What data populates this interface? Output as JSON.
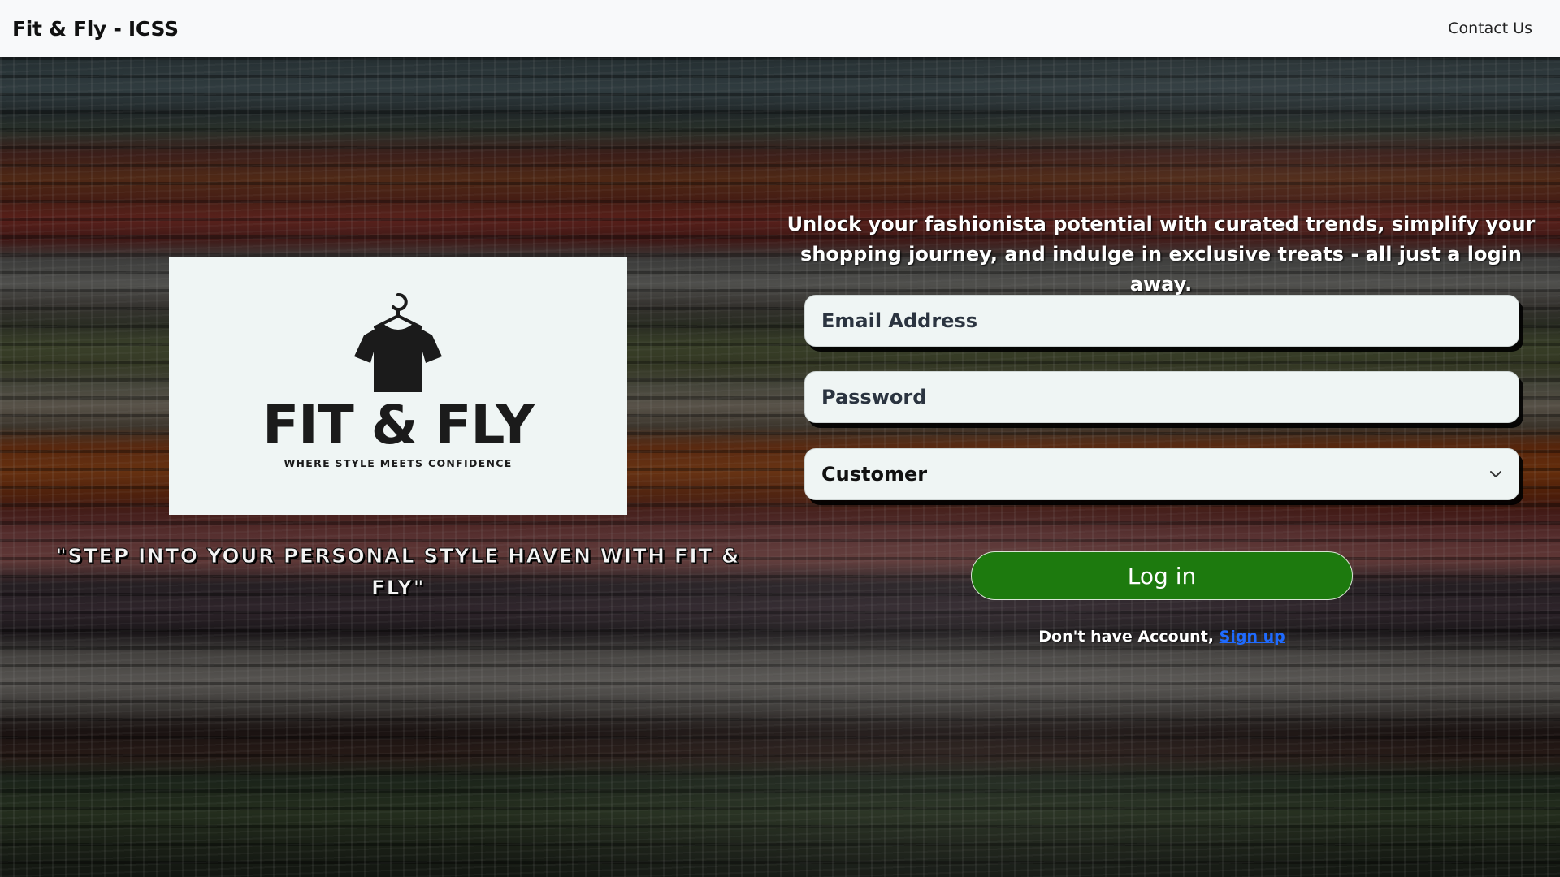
{
  "navbar": {
    "brand": "Fit & Fly - ICSS",
    "contact_link": "Contact Us"
  },
  "logo": {
    "title": "FIT & FLY",
    "tagline": "WHERE STYLE MEETS CONFIDENCE"
  },
  "quote": "\"Step into your personal style haven with Fit & Fly\"",
  "login": {
    "intro": "Unlock your fashionista potential with curated trends, simplify your shopping journey, and indulge in exclusive treats - all just a login away.",
    "email_placeholder": "Email Address",
    "password_placeholder": "Password",
    "role_selected": "Customer",
    "login_button": "Log in",
    "signup_prompt": "Don't have Account,",
    "signup_link": "Sign up"
  },
  "colors": {
    "login_button": "#1d7a0e",
    "link": "#1f6bff",
    "navbar_bg": "#f8f9fa",
    "input_bg": "#eff5f4"
  },
  "icons": {
    "logo_icon": "shirt-on-hanger-icon",
    "select_icon": "chevron-down-icon"
  }
}
